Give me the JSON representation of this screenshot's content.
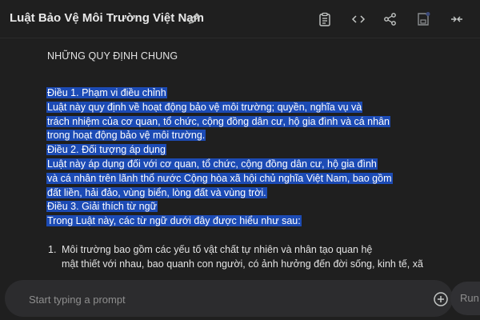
{
  "header": {
    "title": "Luật Bảo Vệ Môi Trường Việt Nam",
    "icons": [
      "edit-icon",
      "clipboard-icon",
      "code-icon",
      "share-icon",
      "save-icon",
      "collapse-icon"
    ]
  },
  "document": {
    "heading": "NHỮNG QUY ĐỊNH CHUNG",
    "selected_lines": [
      "Điều 1. Phạm vi điều chỉnh",
      "Luật này quy định về hoạt động bảo vệ môi trường; quyền, nghĩa vụ và",
      "trách nhiệm của cơ quan, tổ chức, cộng đồng dân cư, hộ gia đình và cá nhân",
      "trong hoạt động bảo vệ môi trường.",
      "Điều 2. Đối tượng áp dụng",
      "Luật này áp dụng đối với cơ quan, tổ chức, cộng đồng dân cư, hộ gia đình",
      "và cá nhân trên lãnh thổ nước Cộng hòa xã hội chủ nghĩa Việt Nam, bao gồm",
      "đất liền, hải đảo, vùng biển, lòng đất và vùng trời.",
      "Điều 3. Giải thích từ ngữ",
      "Trong Luật này, các từ ngữ dưới đây được hiểu như sau:"
    ],
    "list": [
      {
        "number": "1.",
        "lines": [
          "Môi trường bao gồm các yếu tố vật chất tự nhiên và nhân tạo quan hệ",
          "mật thiết với nhau, bao quanh con người, có ảnh hưởng đến đời sống, kinh tế, xã"
        ]
      }
    ]
  },
  "prompt": {
    "placeholder": "Start typing a prompt",
    "run_label": "Run"
  },
  "colors": {
    "background": "#1f1f1f",
    "selection": "#1c4bb5",
    "text": "#e3e3e3"
  }
}
